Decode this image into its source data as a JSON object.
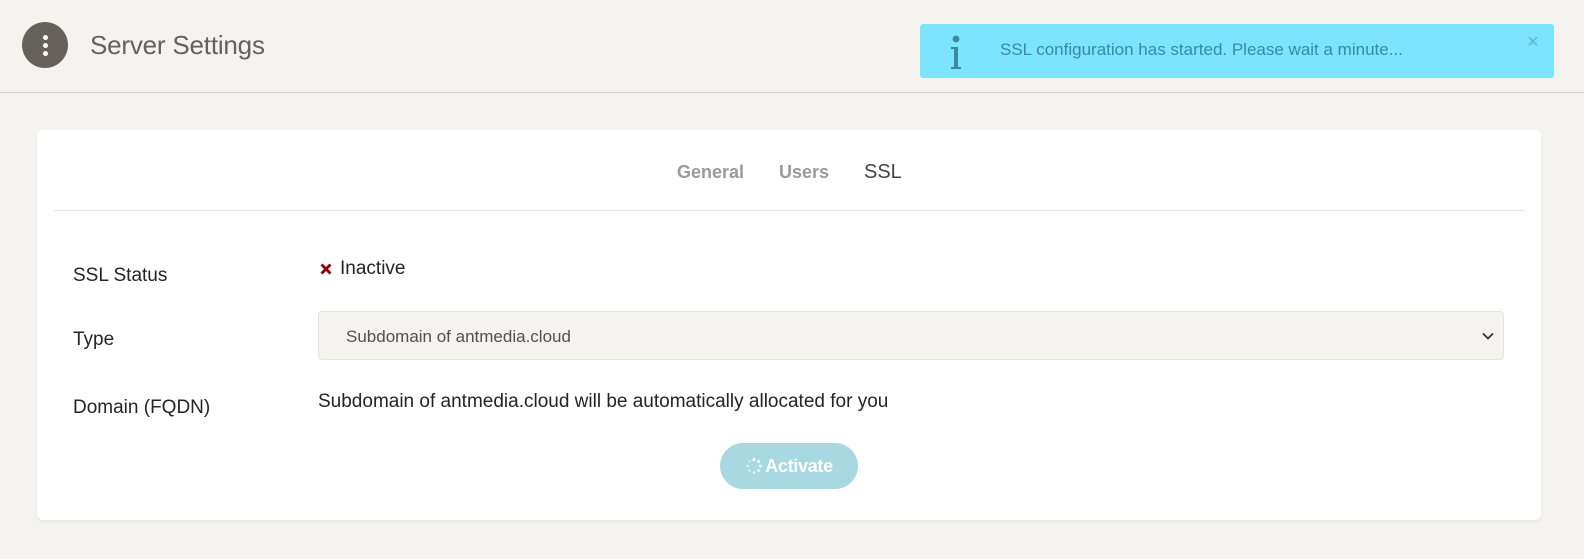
{
  "header": {
    "title": "Server Settings",
    "menu_icon": "vertical-dots-icon"
  },
  "notification": {
    "icon": "info-icon",
    "message": "SSL configuration has started. Please wait a minute...",
    "close_label": "×",
    "color": "#7ce4fe"
  },
  "tabs": [
    {
      "label": "General",
      "active": false
    },
    {
      "label": "Users",
      "active": false
    },
    {
      "label": "SSL",
      "active": true
    }
  ],
  "form": {
    "status_label": "SSL Status",
    "status_value": "Inactive",
    "status_icon": "x-mark-icon",
    "status_color": "#8b0000",
    "type_label": "Type",
    "type_selected": "Subdomain of antmedia.cloud",
    "domain_label": "Domain (FQDN)",
    "domain_value": "Subdomain of antmedia.cloud will be automatically allocated for you",
    "activate_label": "Activate",
    "activate_icon": "spinner-icon"
  }
}
